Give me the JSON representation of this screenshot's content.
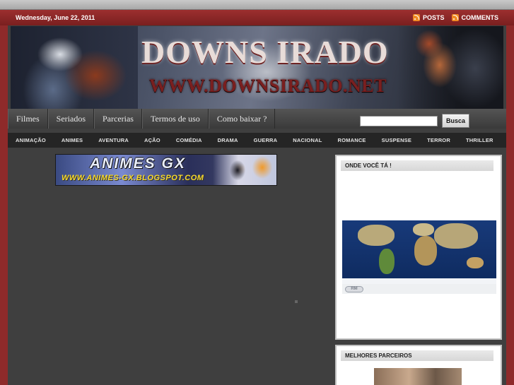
{
  "topbar": {
    "date": "Wednesday, June 22, 2011",
    "posts_label": "POSTS",
    "comments_label": "COMMENTS"
  },
  "header": {
    "title": "DOWNS IRADO",
    "url": "WWW.DOWNSIRADO.NET"
  },
  "nav": {
    "items": [
      "Filmes",
      "Seriados",
      "Parcerias",
      "Termos de uso",
      "Como baixar ?"
    ]
  },
  "search": {
    "value": "",
    "button_label": "Busca"
  },
  "categories": [
    "ANIMAÇÃO",
    "ANIMES",
    "AVENTURA",
    "AÇÃO",
    "COMÉDIA",
    "DRAMA",
    "GUERRA",
    "NACIONAL",
    "ROMANCE",
    "SUSPENSE",
    "TERROR",
    "THRILLER"
  ],
  "banner": {
    "title": "ANIMES GX",
    "url": "WWW.ANIMES-GX.BLOGSPOT.COM"
  },
  "widgets": {
    "location_title": "ONDE VOCÊ TÁ !",
    "map_logo": "RM",
    "partners_title": "MELHORES PARCEIROS"
  },
  "colors": {
    "page_bg": "#8e2a2a",
    "content_bg": "#3f3f3f",
    "nav_bg": "#4a4a4a",
    "category_bg": "#252525",
    "rss": "#f08a24"
  }
}
